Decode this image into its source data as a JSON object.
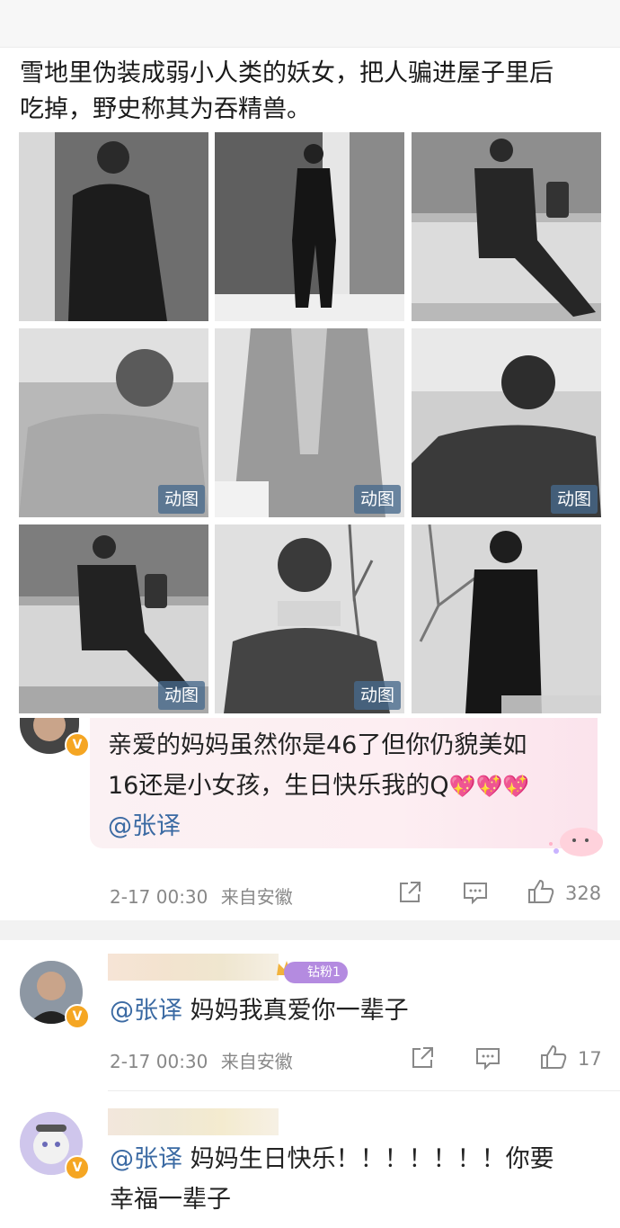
{
  "post": {
    "text_line1": "雪地里伪装成弱小人类的妖女，把人骗进屋子里后",
    "text_line2": "吃掉，野史称其为吞精兽。",
    "gif_badge": "动图"
  },
  "highlight_comment": {
    "line1": "亲爱的妈妈虽然你是46了但你仍貌美如",
    "line2": "16还是小女孩，生日快乐我的Q",
    "mention": "@张译",
    "time": "2-17 00:30",
    "source": "来自安徽",
    "like_count": "328",
    "emoji": "💖💖💖"
  },
  "comment2": {
    "fan_badge": "钻粉1",
    "mention": "@张译",
    "text": " 妈妈我真爱你一辈子",
    "time": "2-17 00:30",
    "source": "来自安徽",
    "like_count": "17"
  },
  "comment3": {
    "mention": "@张译",
    "text_line1": " 妈妈生日快乐！！！！！！！你要",
    "text_line2": "幸福一辈子"
  },
  "icons": [
    "share-icon",
    "comment-icon",
    "like-icon",
    "verified-badge-icon",
    "crown-icon"
  ],
  "colors": {
    "mention": "#3b6aa3",
    "badge_bg": "#46698c",
    "vip": "#f5a623",
    "fan_badge": "#b48be0"
  }
}
